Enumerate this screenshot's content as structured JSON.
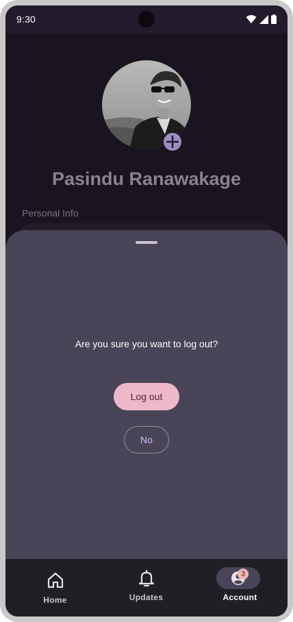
{
  "status_bar": {
    "time": "9:30",
    "icons": [
      "wifi-icon",
      "signal-icon",
      "battery-icon"
    ]
  },
  "profile": {
    "name": "Pasindu Ranawakage",
    "avatar": "avatar-photo",
    "add_photo_icon": "plus-icon"
  },
  "personal_info": {
    "label": "Personal Info"
  },
  "logout_sheet": {
    "message": "Are you sure you want to log out?",
    "confirm_label": "Log out",
    "cancel_label": "No"
  },
  "bottom_nav": {
    "items": [
      {
        "label": "Home",
        "icon": "home-icon"
      },
      {
        "label": "Updates",
        "icon": "bell-icon"
      },
      {
        "label": "Account",
        "icon": "account-icon",
        "badge": "3",
        "selected": true
      }
    ]
  },
  "colors": {
    "background": "#19141f",
    "sheet": "#4a4458",
    "primary_button": "#efb8c8",
    "outline": "#938f99",
    "badge": "#f2b8b5"
  }
}
